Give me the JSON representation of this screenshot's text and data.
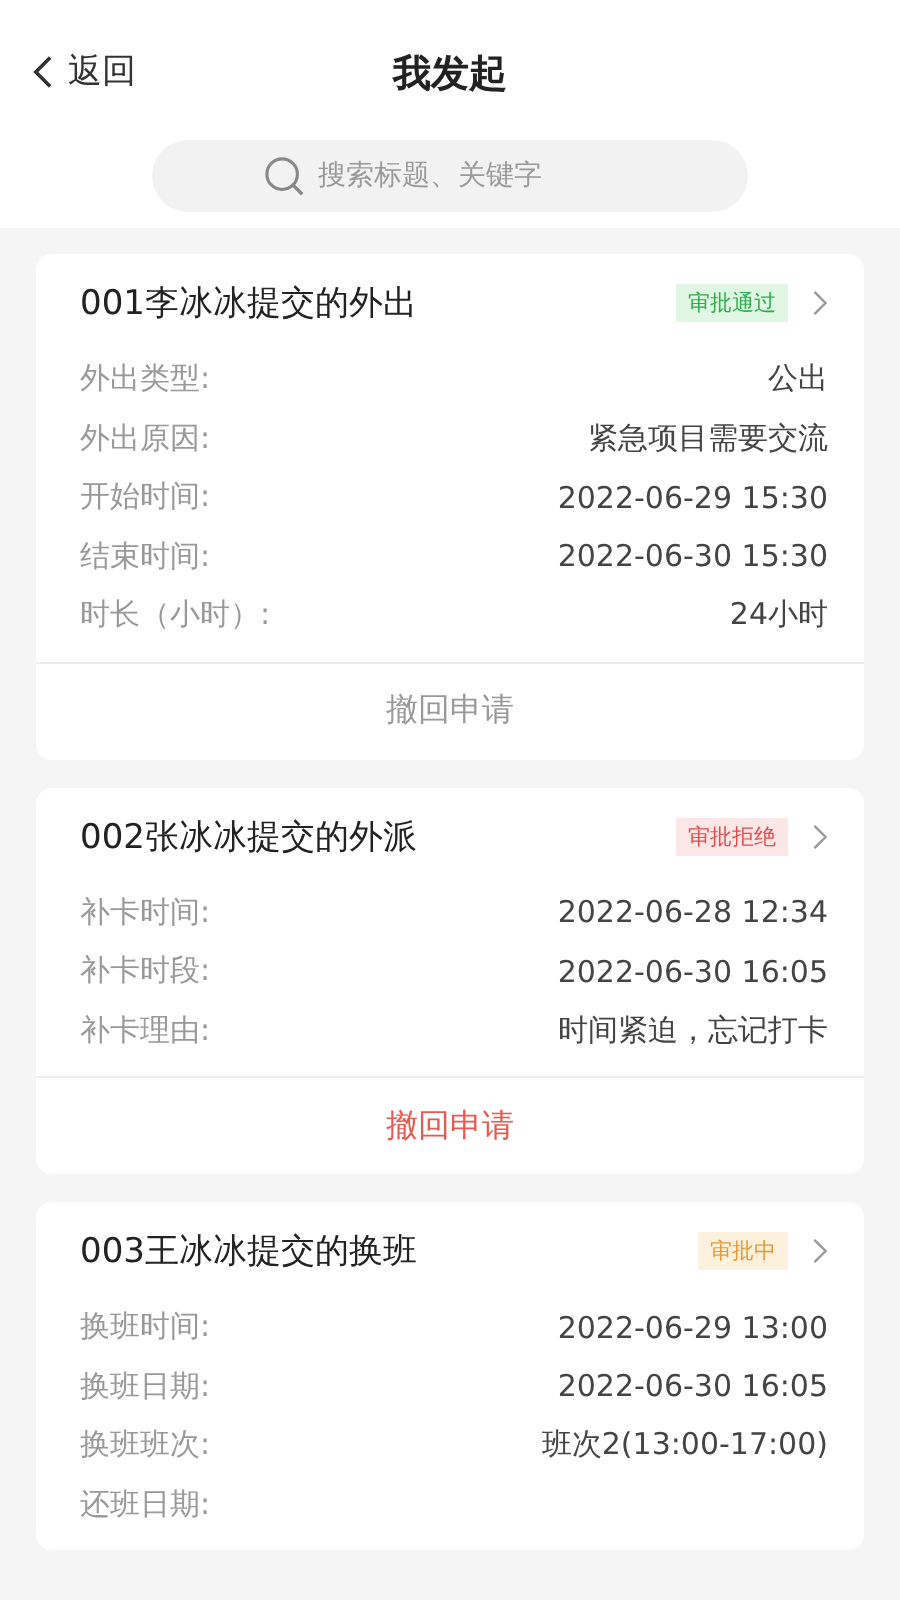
{
  "header": {
    "back": "返回",
    "title": "我发起"
  },
  "search": {
    "placeholder": "搜索标题、关键字"
  },
  "cards": [
    {
      "title": "001李冰冰提交的外出",
      "status": {
        "text": "审批通过",
        "kind": "approved"
      },
      "fields": [
        {
          "label": "外出类型:",
          "value": "公出"
        },
        {
          "label": "外出原因:",
          "value": "紧急项目需要交流"
        },
        {
          "label": "开始时间:",
          "value": "2022-06-29 15:30"
        },
        {
          "label": "结束时间:",
          "value": "2022-06-30 15:30"
        },
        {
          "label": "时长（小时）:",
          "value": "24小时"
        }
      ],
      "action": {
        "label": "撤回申请",
        "disabled": true
      }
    },
    {
      "title": "002张冰冰提交的外派",
      "status": {
        "text": "审批拒绝",
        "kind": "rejected"
      },
      "fields": [
        {
          "label": "补卡时间:",
          "value": "2022-06-28 12:34"
        },
        {
          "label": "补卡时段:",
          "value": "2022-06-30 16:05"
        },
        {
          "label": "补卡理由:",
          "value": "时间紧迫，忘记打卡"
        }
      ],
      "action": {
        "label": "撤回申请",
        "disabled": false
      }
    },
    {
      "title": "003王冰冰提交的换班",
      "status": {
        "text": "审批中",
        "kind": "pending"
      },
      "fields": [
        {
          "label": "换班时间:",
          "value": "2022-06-29 13:00"
        },
        {
          "label": "换班日期:",
          "value": "2022-06-30 16:05"
        },
        {
          "label": "换班班次:",
          "value": "班次2(13:00-17:00)"
        },
        {
          "label": "还班日期:"
        }
      ]
    }
  ]
}
